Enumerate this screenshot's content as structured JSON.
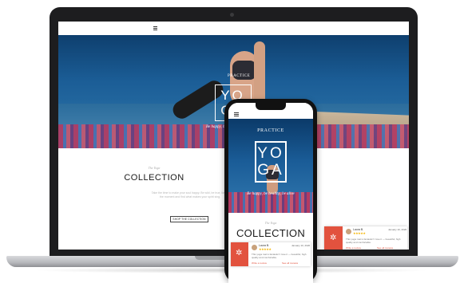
{
  "site": {
    "hero": {
      "practice": "PRACTICE",
      "logo_line1": "YO",
      "logo_line2": "GA",
      "tagline": "Be happy, be healthy, be alive"
    },
    "collection": {
      "eyebrow": "The Yoga",
      "title": "COLLECTION",
      "description": "Take the time to make your soul happy. Be wild, be true, live in the moment and find what makes your spirit sing.",
      "button": "SHOP THE COLLECTION"
    }
  },
  "review": {
    "name": "Laura B.",
    "stars": "★★★★★",
    "date": "January 10, 2020",
    "text": "This yoga mat is fantastic! I love it — beautiful, high quality and comfortable.",
    "link_left": "Write a review",
    "link_right": "See all reviews"
  },
  "colors": {
    "accent": "#e2523e",
    "star": "#f5b400",
    "ocean": "#1b5d96"
  },
  "icons": {
    "menu": "hamburger-menu-icon",
    "widget": "asterisk-logo-icon"
  }
}
